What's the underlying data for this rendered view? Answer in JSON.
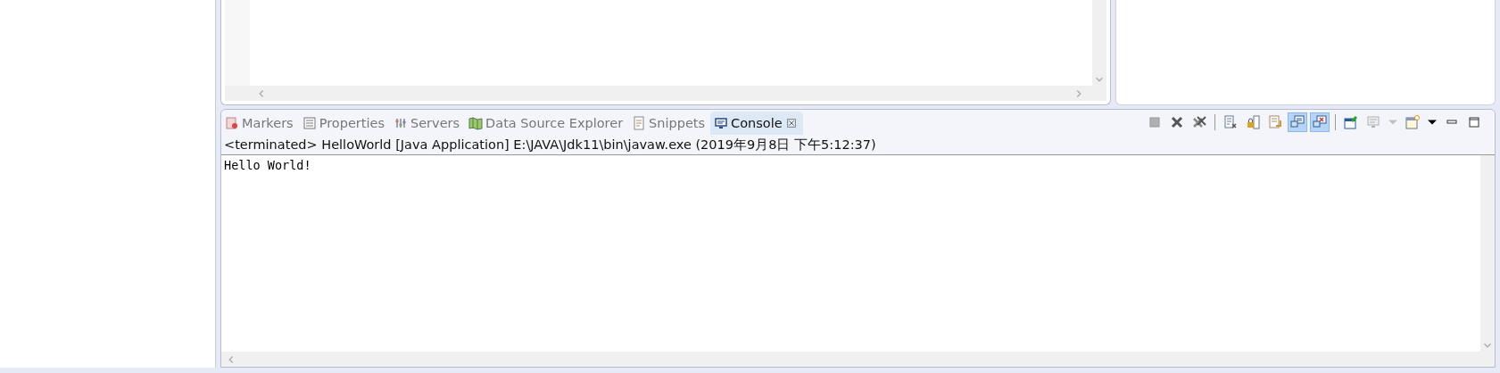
{
  "tabs": [
    {
      "label": "Markers",
      "kind": "markers",
      "selected": false
    },
    {
      "label": "Properties",
      "kind": "properties",
      "selected": false
    },
    {
      "label": "Servers",
      "kind": "servers",
      "selected": false
    },
    {
      "label": "Data Source Explorer",
      "kind": "datasource",
      "selected": false
    },
    {
      "label": "Snippets",
      "kind": "snippets",
      "selected": false
    },
    {
      "label": "Console",
      "kind": "console",
      "selected": true
    }
  ],
  "toolbar": [
    {
      "kind": "terminate",
      "disabled": true,
      "selected": false
    },
    {
      "kind": "remove",
      "disabled": false,
      "selected": false
    },
    {
      "kind": "remove-all",
      "disabled": false,
      "selected": false
    },
    {
      "kind": "separator"
    },
    {
      "kind": "clear",
      "disabled": false,
      "selected": false
    },
    {
      "kind": "scroll-lock",
      "disabled": false,
      "selected": false
    },
    {
      "kind": "word-wrap",
      "disabled": false,
      "selected": false
    },
    {
      "kind": "show-stdout",
      "disabled": false,
      "selected": true
    },
    {
      "kind": "show-stderr",
      "disabled": false,
      "selected": true
    },
    {
      "kind": "separator"
    },
    {
      "kind": "pin",
      "disabled": false,
      "selected": false
    },
    {
      "kind": "display",
      "disabled": true,
      "selected": false
    },
    {
      "kind": "dropdown",
      "disabled": true,
      "selected": false
    },
    {
      "kind": "new-console",
      "disabled": false,
      "selected": false
    },
    {
      "kind": "dropdown",
      "disabled": false,
      "selected": false
    },
    {
      "kind": "minimize",
      "disabled": false,
      "selected": false
    },
    {
      "kind": "maximize",
      "disabled": false,
      "selected": false
    }
  ],
  "console": {
    "status": "<terminated> HelloWorld [Java Application] E:\\JAVA\\Jdk11\\bin\\javaw.exe (2019年9月8日 下午5:12:37)",
    "output": "Hello World!"
  }
}
